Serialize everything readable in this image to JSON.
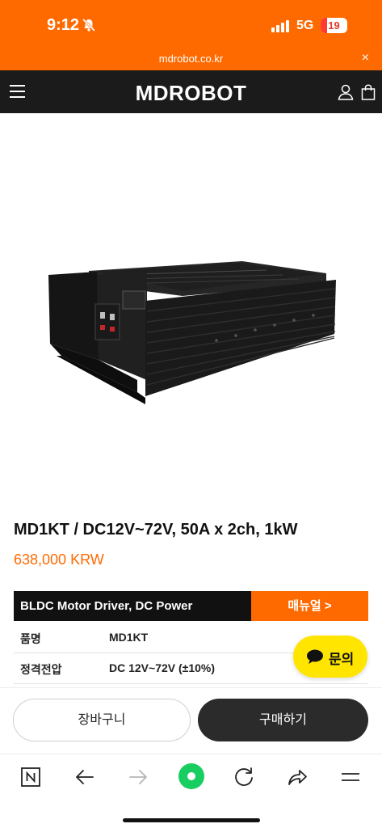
{
  "status_bar": {
    "time": "9:12",
    "network": "5G",
    "battery": "19"
  },
  "browser": {
    "url": "mdrobot.co.kr",
    "close_glyph": "×"
  },
  "header": {
    "logo": "MDROBOT",
    "icons": [
      "menu-icon",
      "user-icon",
      "shopping-bag-icon"
    ]
  },
  "product": {
    "title": "MD1KT / DC12V~72V, 50A x 2ch, 1kW",
    "price": "638,000 KRW",
    "banner_left": "BLDC Motor Driver, DC Power",
    "banner_right": "매뉴얼  >",
    "specs": [
      {
        "key": "품명",
        "value": "MD1KT"
      },
      {
        "key": "정격전압",
        "value": "DC 12V~72V (±10%)"
      }
    ]
  },
  "inquiry_button": {
    "label": "문의"
  },
  "actions": {
    "cart": "장바구니",
    "buy": "구매하기"
  },
  "toolbar": {
    "icons": [
      "naver-home-icon",
      "back-arrow-icon",
      "forward-arrow-icon",
      "green-dot-icon",
      "refresh-icon",
      "share-icon",
      "menu-icon"
    ]
  },
  "colors": {
    "accent": "#ff6a00",
    "header_bg": "#1b1b1b",
    "inquiry": "#ffe500",
    "green": "#19ce60"
  }
}
